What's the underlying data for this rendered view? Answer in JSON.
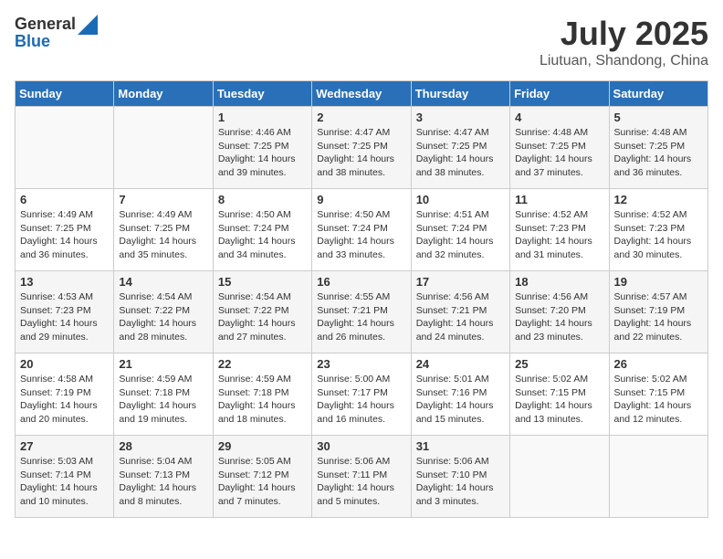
{
  "header": {
    "logo_general": "General",
    "logo_blue": "Blue",
    "month": "July 2025",
    "location": "Liutuan, Shandong, China"
  },
  "weekdays": [
    "Sunday",
    "Monday",
    "Tuesday",
    "Wednesday",
    "Thursday",
    "Friday",
    "Saturday"
  ],
  "weeks": [
    [
      {
        "day": "",
        "sunrise": "",
        "sunset": "",
        "daylight": ""
      },
      {
        "day": "",
        "sunrise": "",
        "sunset": "",
        "daylight": ""
      },
      {
        "day": "1",
        "sunrise": "Sunrise: 4:46 AM",
        "sunset": "Sunset: 7:25 PM",
        "daylight": "Daylight: 14 hours and 39 minutes."
      },
      {
        "day": "2",
        "sunrise": "Sunrise: 4:47 AM",
        "sunset": "Sunset: 7:25 PM",
        "daylight": "Daylight: 14 hours and 38 minutes."
      },
      {
        "day": "3",
        "sunrise": "Sunrise: 4:47 AM",
        "sunset": "Sunset: 7:25 PM",
        "daylight": "Daylight: 14 hours and 38 minutes."
      },
      {
        "day": "4",
        "sunrise": "Sunrise: 4:48 AM",
        "sunset": "Sunset: 7:25 PM",
        "daylight": "Daylight: 14 hours and 37 minutes."
      },
      {
        "day": "5",
        "sunrise": "Sunrise: 4:48 AM",
        "sunset": "Sunset: 7:25 PM",
        "daylight": "Daylight: 14 hours and 36 minutes."
      }
    ],
    [
      {
        "day": "6",
        "sunrise": "Sunrise: 4:49 AM",
        "sunset": "Sunset: 7:25 PM",
        "daylight": "Daylight: 14 hours and 36 minutes."
      },
      {
        "day": "7",
        "sunrise": "Sunrise: 4:49 AM",
        "sunset": "Sunset: 7:25 PM",
        "daylight": "Daylight: 14 hours and 35 minutes."
      },
      {
        "day": "8",
        "sunrise": "Sunrise: 4:50 AM",
        "sunset": "Sunset: 7:24 PM",
        "daylight": "Daylight: 14 hours and 34 minutes."
      },
      {
        "day": "9",
        "sunrise": "Sunrise: 4:50 AM",
        "sunset": "Sunset: 7:24 PM",
        "daylight": "Daylight: 14 hours and 33 minutes."
      },
      {
        "day": "10",
        "sunrise": "Sunrise: 4:51 AM",
        "sunset": "Sunset: 7:24 PM",
        "daylight": "Daylight: 14 hours and 32 minutes."
      },
      {
        "day": "11",
        "sunrise": "Sunrise: 4:52 AM",
        "sunset": "Sunset: 7:23 PM",
        "daylight": "Daylight: 14 hours and 31 minutes."
      },
      {
        "day": "12",
        "sunrise": "Sunrise: 4:52 AM",
        "sunset": "Sunset: 7:23 PM",
        "daylight": "Daylight: 14 hours and 30 minutes."
      }
    ],
    [
      {
        "day": "13",
        "sunrise": "Sunrise: 4:53 AM",
        "sunset": "Sunset: 7:23 PM",
        "daylight": "Daylight: 14 hours and 29 minutes."
      },
      {
        "day": "14",
        "sunrise": "Sunrise: 4:54 AM",
        "sunset": "Sunset: 7:22 PM",
        "daylight": "Daylight: 14 hours and 28 minutes."
      },
      {
        "day": "15",
        "sunrise": "Sunrise: 4:54 AM",
        "sunset": "Sunset: 7:22 PM",
        "daylight": "Daylight: 14 hours and 27 minutes."
      },
      {
        "day": "16",
        "sunrise": "Sunrise: 4:55 AM",
        "sunset": "Sunset: 7:21 PM",
        "daylight": "Daylight: 14 hours and 26 minutes."
      },
      {
        "day": "17",
        "sunrise": "Sunrise: 4:56 AM",
        "sunset": "Sunset: 7:21 PM",
        "daylight": "Daylight: 14 hours and 24 minutes."
      },
      {
        "day": "18",
        "sunrise": "Sunrise: 4:56 AM",
        "sunset": "Sunset: 7:20 PM",
        "daylight": "Daylight: 14 hours and 23 minutes."
      },
      {
        "day": "19",
        "sunrise": "Sunrise: 4:57 AM",
        "sunset": "Sunset: 7:19 PM",
        "daylight": "Daylight: 14 hours and 22 minutes."
      }
    ],
    [
      {
        "day": "20",
        "sunrise": "Sunrise: 4:58 AM",
        "sunset": "Sunset: 7:19 PM",
        "daylight": "Daylight: 14 hours and 20 minutes."
      },
      {
        "day": "21",
        "sunrise": "Sunrise: 4:59 AM",
        "sunset": "Sunset: 7:18 PM",
        "daylight": "Daylight: 14 hours and 19 minutes."
      },
      {
        "day": "22",
        "sunrise": "Sunrise: 4:59 AM",
        "sunset": "Sunset: 7:18 PM",
        "daylight": "Daylight: 14 hours and 18 minutes."
      },
      {
        "day": "23",
        "sunrise": "Sunrise: 5:00 AM",
        "sunset": "Sunset: 7:17 PM",
        "daylight": "Daylight: 14 hours and 16 minutes."
      },
      {
        "day": "24",
        "sunrise": "Sunrise: 5:01 AM",
        "sunset": "Sunset: 7:16 PM",
        "daylight": "Daylight: 14 hours and 15 minutes."
      },
      {
        "day": "25",
        "sunrise": "Sunrise: 5:02 AM",
        "sunset": "Sunset: 7:15 PM",
        "daylight": "Daylight: 14 hours and 13 minutes."
      },
      {
        "day": "26",
        "sunrise": "Sunrise: 5:02 AM",
        "sunset": "Sunset: 7:15 PM",
        "daylight": "Daylight: 14 hours and 12 minutes."
      }
    ],
    [
      {
        "day": "27",
        "sunrise": "Sunrise: 5:03 AM",
        "sunset": "Sunset: 7:14 PM",
        "daylight": "Daylight: 14 hours and 10 minutes."
      },
      {
        "day": "28",
        "sunrise": "Sunrise: 5:04 AM",
        "sunset": "Sunset: 7:13 PM",
        "daylight": "Daylight: 14 hours and 8 minutes."
      },
      {
        "day": "29",
        "sunrise": "Sunrise: 5:05 AM",
        "sunset": "Sunset: 7:12 PM",
        "daylight": "Daylight: 14 hours and 7 minutes."
      },
      {
        "day": "30",
        "sunrise": "Sunrise: 5:06 AM",
        "sunset": "Sunset: 7:11 PM",
        "daylight": "Daylight: 14 hours and 5 minutes."
      },
      {
        "day": "31",
        "sunrise": "Sunrise: 5:06 AM",
        "sunset": "Sunset: 7:10 PM",
        "daylight": "Daylight: 14 hours and 3 minutes."
      },
      {
        "day": "",
        "sunrise": "",
        "sunset": "",
        "daylight": ""
      },
      {
        "day": "",
        "sunrise": "",
        "sunset": "",
        "daylight": ""
      }
    ]
  ]
}
